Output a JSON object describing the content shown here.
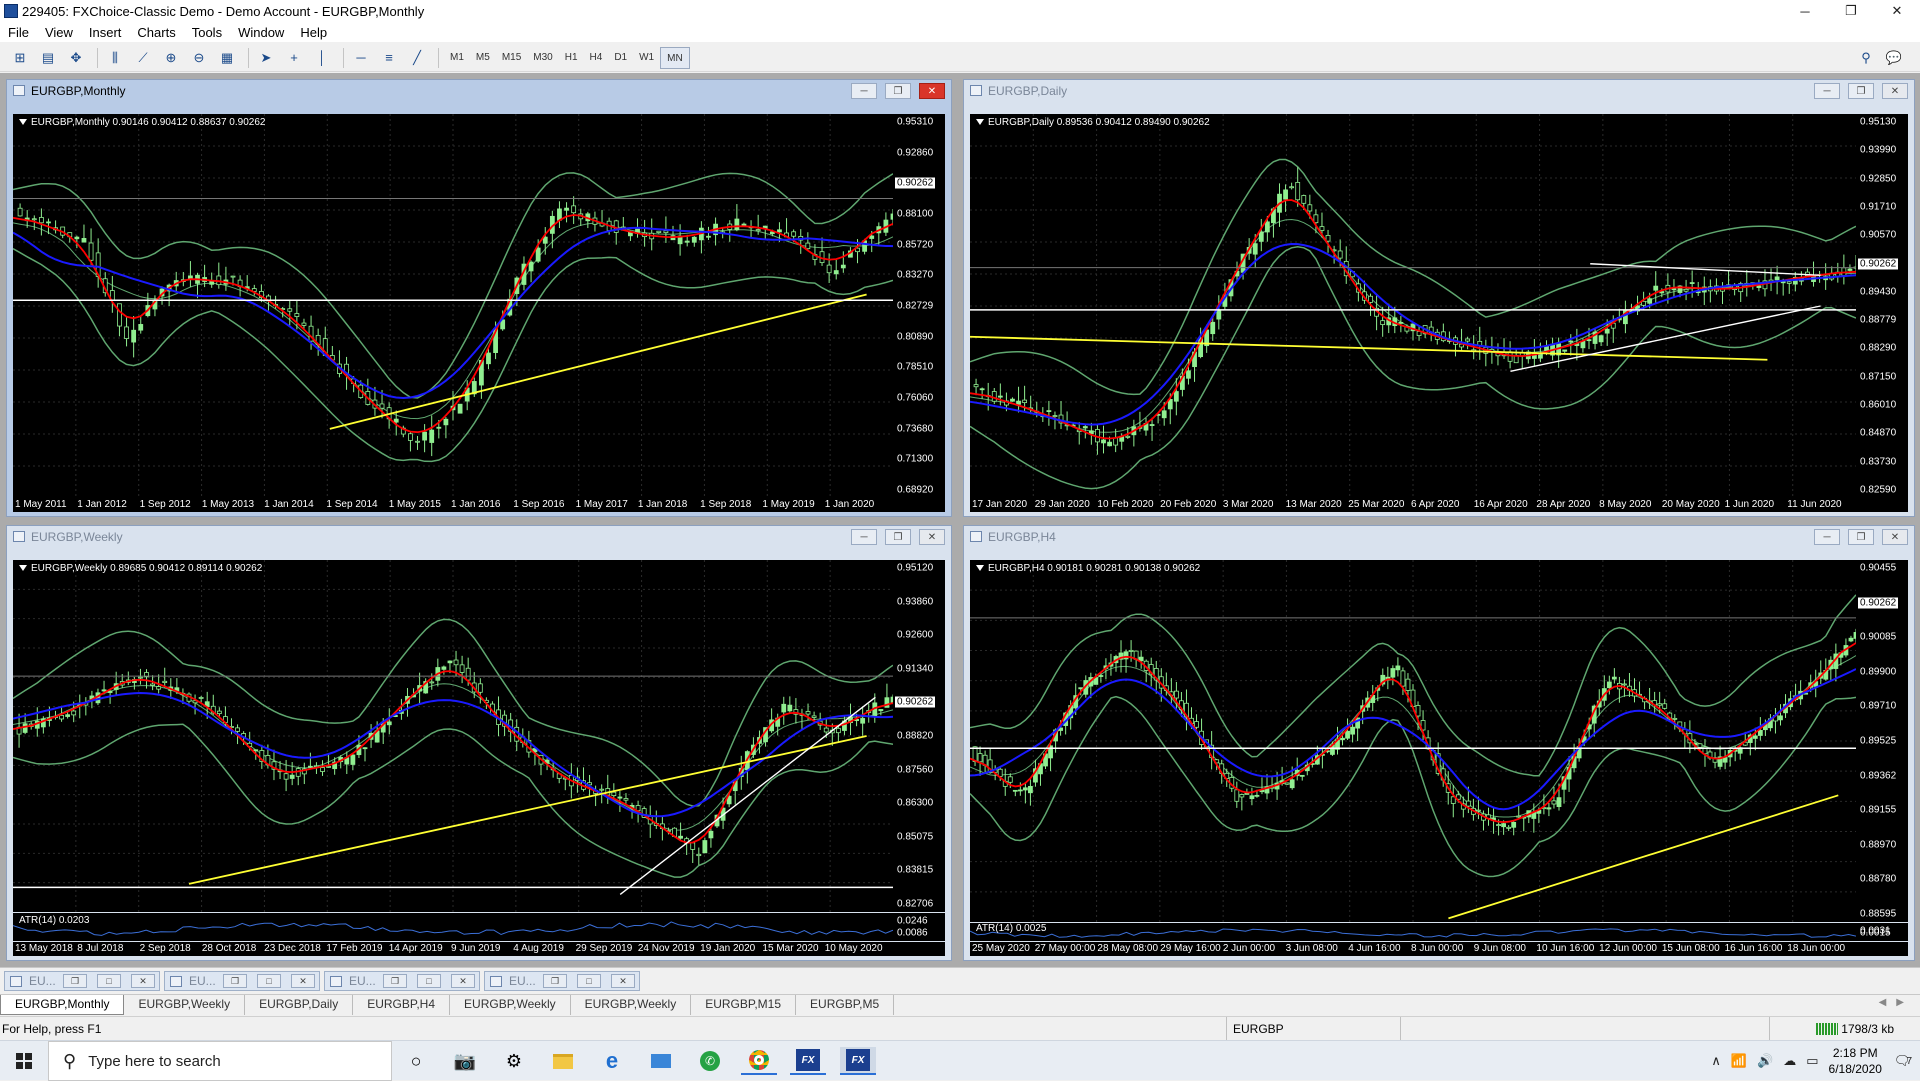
{
  "window": {
    "title": "229405: FXChoice-Classic Demo - Demo Account - EURGBP,Monthly",
    "controls": {
      "minimize": "─",
      "restore": "❐",
      "close": "✕"
    }
  },
  "menu": [
    "File",
    "View",
    "Insert",
    "Charts",
    "Tools",
    "Window",
    "Help"
  ],
  "toolbar": {
    "timeframes": [
      "M1",
      "M5",
      "M15",
      "M30",
      "H1",
      "H4",
      "D1",
      "W1",
      "MN"
    ],
    "active_timeframe": "MN"
  },
  "charts": [
    {
      "id": "monthly",
      "window_title": "EURGBP,Monthly",
      "info": "EURGBP,Monthly  0.90146 0.90412 0.88637 0.90262",
      "active": true,
      "y_ticks": [
        "0.95310",
        "0.92860",
        "0.90262",
        "0.88100",
        "0.85720",
        "0.83270",
        "0.82729",
        "0.80890",
        "0.78510",
        "0.76060",
        "0.73680",
        "0.71300",
        "0.68920"
      ],
      "current_price": "0.90262",
      "hline_price": "0.82729",
      "x_ticks": [
        "1 May 2011",
        "1 Jan 2012",
        "1 Sep 2012",
        "1 May 2013",
        "1 Jan 2014",
        "1 Sep 2014",
        "1 May 2015",
        "1 Jan 2016",
        "1 Sep 2016",
        "1 May 2017",
        "1 Jan 2018",
        "1 Sep 2018",
        "1 May 2019",
        "1 Jan 2020"
      ]
    },
    {
      "id": "daily",
      "window_title": "EURGBP,Daily",
      "info": "EURGBP,Daily  0.89536 0.90412 0.89490 0.90262",
      "active": false,
      "y_ticks": [
        "0.95130",
        "0.93990",
        "0.92850",
        "0.91710",
        "0.90570",
        "0.90262",
        "0.89430",
        "0.88779",
        "0.88290",
        "0.87150",
        "0.86010",
        "0.84870",
        "0.83730",
        "0.82590"
      ],
      "current_price": "0.90262",
      "hline_price": "0.88779",
      "x_ticks": [
        "17 Jan 2020",
        "29 Jan 2020",
        "10 Feb 2020",
        "20 Feb 2020",
        "3 Mar 2020",
        "13 Mar 2020",
        "25 Mar 2020",
        "6 Apr 2020",
        "16 Apr 2020",
        "28 Apr 2020",
        "8 May 2020",
        "20 May 2020",
        "1 Jun 2020",
        "11 Jun 2020"
      ]
    },
    {
      "id": "weekly",
      "window_title": "EURGBP,Weekly",
      "info": "EURGBP,Weekly  0.89685 0.90412 0.89114 0.90262",
      "active": false,
      "y_ticks": [
        "0.95120",
        "0.93860",
        "0.92600",
        "0.91340",
        "0.90262",
        "0.88820",
        "0.87560",
        "0.86300",
        "0.85075",
        "0.83815",
        "0.82706"
      ],
      "atr_label": "ATR(14) 0.0203",
      "atr_ticks": [
        "0.0246",
        "0.0086"
      ],
      "current_price": "0.90262",
      "hline_price": "0.82706",
      "x_ticks": [
        "13 May 2018",
        "8 Jul 2018",
        "2 Sep 2018",
        "28 Oct 2018",
        "23 Dec 2018",
        "17 Feb 2019",
        "14 Apr 2019",
        "9 Jun 2019",
        "4 Aug 2019",
        "29 Sep 2019",
        "24 Nov 2019",
        "19 Jan 2020",
        "15 Mar 2020",
        "10 May 2020"
      ]
    },
    {
      "id": "h4",
      "window_title": "EURGBP,H4",
      "info": "EURGBP,H4  0.90181 0.90281 0.90138 0.90262",
      "active": false,
      "y_ticks": [
        "0.90455",
        "0.90262",
        "0.90085",
        "0.89900",
        "0.89710",
        "0.89525",
        "0.89362",
        "0.89155",
        "0.88970",
        "0.88780",
        "0.88595"
      ],
      "atr_label": "ATR(14) 0.0025",
      "atr_ticks": [
        "0.0031",
        "0.0015"
      ],
      "current_price": "0.90262",
      "hline_price": "0.89362",
      "x_ticks": [
        "25 May 2020",
        "27 May 00:00",
        "28 May 08:00",
        "29 May 16:00",
        "2 Jun 00:00",
        "3 Jun 08:00",
        "4 Jun 16:00",
        "8 Jun 00:00",
        "9 Jun 08:00",
        "10 Jun 16:00",
        "12 Jun 00:00",
        "15 Jun 08:00",
        "16 Jun 16:00",
        "18 Jun 00:00"
      ]
    }
  ],
  "minimized_windows": [
    "EU...",
    "EU...",
    "EU...",
    "EU..."
  ],
  "chart_tabs": [
    "EURGBP,Monthly",
    "EURGBP,Weekly",
    "EURGBP,Daily",
    "EURGBP,H4",
    "EURGBP,Weekly",
    "EURGBP,Weekly",
    "EURGBP,M15",
    "EURGBP,M5"
  ],
  "active_tab": 0,
  "status": {
    "help": "For Help, press F1",
    "symbol": "EURGBP",
    "traffic": "1798/3 kb"
  },
  "taskbar": {
    "search_placeholder": "Type here to search",
    "time": "2:18 PM",
    "date": "6/18/2020",
    "notifications": "7"
  },
  "colors": {
    "bull_candle": "#90ee90",
    "bear_candle": "#000000",
    "bollinger": "#5fa66f",
    "ma_fast": "#ff0000",
    "ma_mid": "#1a1aff",
    "ma_slow": "#ffff33",
    "hline": "#ffffff"
  }
}
